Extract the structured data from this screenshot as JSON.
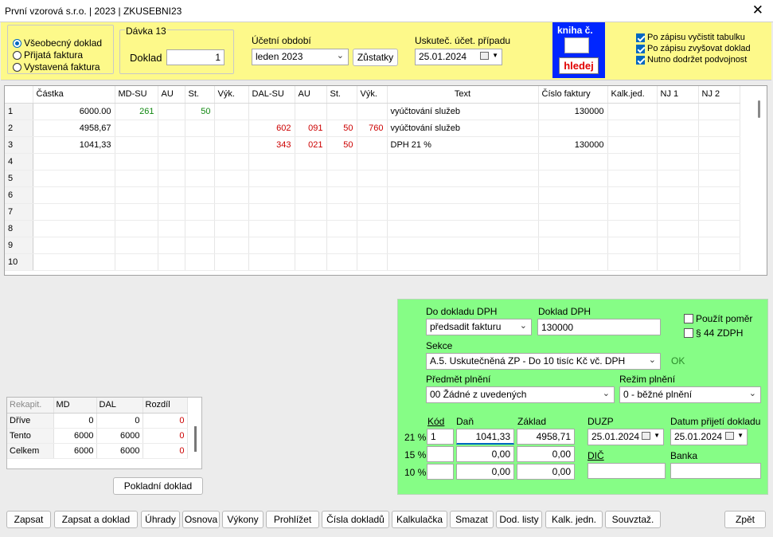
{
  "window": {
    "title": "První vzorová s.r.o.  |  2023  |  ZKUSEBNI23",
    "close_glyph": "✕"
  },
  "doc_type": {
    "options": [
      {
        "label": "Všeobecný doklad",
        "selected": true
      },
      {
        "label": "Přijatá faktura",
        "selected": false
      },
      {
        "label": "Vystavená faktura",
        "selected": false
      }
    ]
  },
  "batch": {
    "title": "Dávka 13",
    "doklad_label": "Doklad",
    "doklad_value": "1"
  },
  "period": {
    "label": "Účetní období",
    "value": "leden 2023",
    "zustatky_label": "Zůstatky"
  },
  "uskutec": {
    "label": "Uskuteč. účet. případu",
    "value": "25.01.2024"
  },
  "kniha": {
    "title": "kniha č.",
    "value": "",
    "search_label": "hledej"
  },
  "options": [
    {
      "label": "Po zápisu vyčistit tabulku",
      "checked": true
    },
    {
      "label": "Po zápisu zvyšovat doklad",
      "checked": true
    },
    {
      "label": "Nutno dodržet podvojnost",
      "checked": true
    }
  ],
  "grid": {
    "headers": [
      "",
      "Částka",
      "MD-SU",
      "AU",
      "St.",
      "Výk.",
      "DAL-SU",
      "AU",
      "St.",
      "Výk.",
      "Text",
      "Číslo faktury",
      "Kalk.jed.",
      "NJ 1",
      "NJ 2"
    ],
    "rows": [
      [
        "1",
        "6000.00",
        "261",
        "",
        "50",
        "",
        "",
        "",
        "",
        "",
        "vyúčtování služeb",
        "130000",
        "",
        "",
        ""
      ],
      [
        "2",
        "4958,67",
        "",
        "",
        "",
        "",
        "602",
        "091",
        "50",
        "760",
        "vyúčtování služeb",
        "",
        "",
        "",
        ""
      ],
      [
        "3",
        "1041,33",
        "",
        "",
        "",
        "",
        "343",
        "021",
        "50",
        "",
        "DPH 21 %",
        "130000",
        "",
        "",
        ""
      ],
      [
        "4",
        "",
        "",
        "",
        "",
        "",
        "",
        "",
        "",
        "",
        "",
        "",
        "",
        "",
        ""
      ],
      [
        "5",
        "",
        "",
        "",
        "",
        "",
        "",
        "",
        "",
        "",
        "",
        "",
        "",
        "",
        ""
      ],
      [
        "6",
        "",
        "",
        "",
        "",
        "",
        "",
        "",
        "",
        "",
        "",
        "",
        "",
        "",
        ""
      ],
      [
        "7",
        "",
        "",
        "",
        "",
        "",
        "",
        "",
        "",
        "",
        "",
        "",
        "",
        "",
        ""
      ],
      [
        "8",
        "",
        "",
        "",
        "",
        "",
        "",
        "",
        "",
        "",
        "",
        "",
        "",
        "",
        ""
      ],
      [
        "9",
        "",
        "",
        "",
        "",
        "",
        "",
        "",
        "",
        "",
        "",
        "",
        "",
        "",
        ""
      ],
      [
        "10",
        "",
        "",
        "",
        "",
        "",
        "",
        "",
        "",
        "",
        "",
        "",
        "",
        "",
        ""
      ]
    ]
  },
  "recap": {
    "headers": [
      "Rekapit.",
      "MD",
      "DAL",
      "Rozdíl"
    ],
    "rows": [
      [
        "Dříve",
        "0",
        "0",
        "0"
      ],
      [
        "Tento",
        "6000",
        "6000",
        "0"
      ],
      [
        "Celkem",
        "6000",
        "6000",
        "0"
      ]
    ]
  },
  "pokladni_label": "Pokladní doklad",
  "vat": {
    "do_dokladu_label": "Do dokladu DPH",
    "do_dokladu_value": "předsadit fakturu",
    "doklad_dph_label": "Doklad DPH",
    "doklad_dph_value": "130000",
    "pouzit_pomer": "Použít poměr",
    "par44": "§ 44 ZDPH",
    "sekce_label": "Sekce",
    "sekce_value": "A.5. Uskutečněná ZP - Do 10 tisíc Kč vč. DPH",
    "ok_label": "OK",
    "predmet_label": "Předmět plnění",
    "predmet_value": "00 Žádné z uvedených",
    "rezim_label": "Režim plnění",
    "rezim_value": "0 - běžné plnění",
    "kod_label": "Kód",
    "dan_label": "Daň",
    "zaklad_label": "Základ",
    "duzp_label": "DUZP",
    "duzp_value": "25.01.2024",
    "datum_prijeti_label": "Datum přijetí dokladu",
    "datum_prijeti_value": "25.01.2024",
    "dic_label": "DIČ",
    "banka_label": "Banka",
    "rates": [
      {
        "rate": "21 %",
        "kod": "1",
        "dan": "1041,33",
        "zaklad": "4958,71"
      },
      {
        "rate": "15 %",
        "kod": "",
        "dan": "0,00",
        "zaklad": "0,00"
      },
      {
        "rate": "10 %",
        "kod": "",
        "dan": "0,00",
        "zaklad": "0,00"
      }
    ]
  },
  "footer": [
    "Zapsat",
    "Zapsat a doklad",
    "Úhrady",
    "Osnova",
    "Výkony",
    "Prohlížet",
    "Čísla dokladů",
    "Kalkulačka",
    "Smazat",
    "Dod. listy",
    "Kalk. jedn.",
    "Souvztaž."
  ],
  "zpet_label": "Zpět"
}
